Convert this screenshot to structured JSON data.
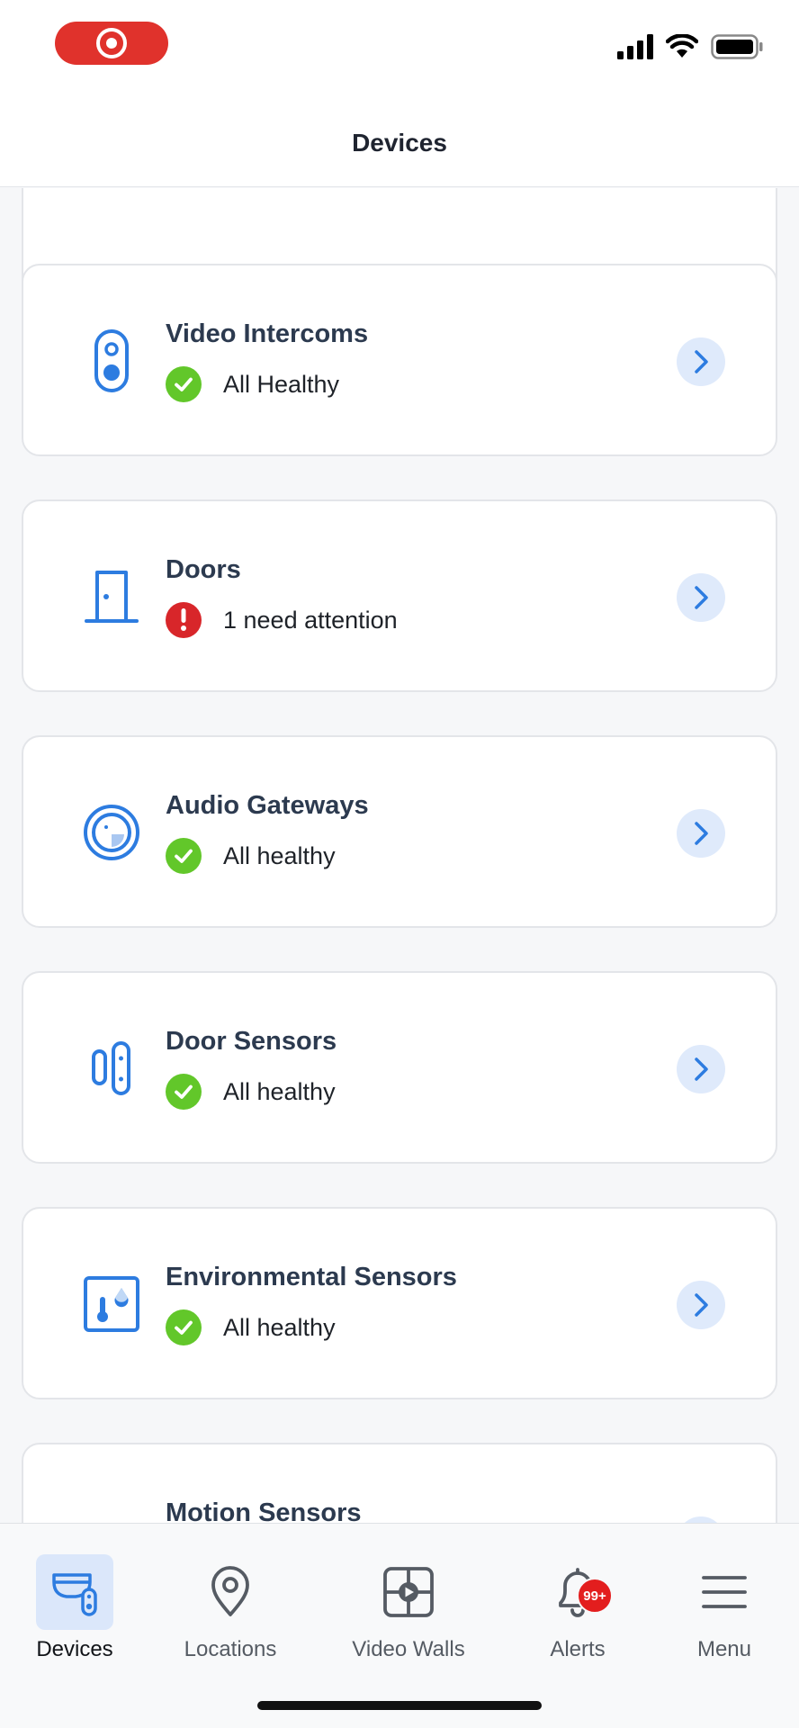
{
  "header": {
    "title": "Devices"
  },
  "colors": {
    "accent": "#2d7ce0",
    "healthy": "#62c72a",
    "alert": "#d8262a",
    "badge": "#e31e1e"
  },
  "device_groups": [
    {
      "title": "Video Intercoms",
      "status": "All Healthy",
      "status_type": "healthy",
      "icon": "video-intercom-icon"
    },
    {
      "title": "Doors",
      "status": "1 need attention",
      "status_type": "alert",
      "icon": "door-icon"
    },
    {
      "title": "Audio Gateways",
      "status": "All healthy",
      "status_type": "healthy",
      "icon": "audio-gateway-icon"
    },
    {
      "title": "Door Sensors",
      "status": "All healthy",
      "status_type": "healthy",
      "icon": "door-sensor-icon"
    },
    {
      "title": "Environmental Sensors",
      "status": "All healthy",
      "status_type": "healthy",
      "icon": "environmental-sensor-icon"
    },
    {
      "title": "Motion Sensors",
      "icon": "motion-sensor-icon"
    }
  ],
  "bottom_nav": [
    {
      "label": "Devices",
      "icon": "devices-icon",
      "active": true
    },
    {
      "label": "Locations",
      "icon": "location-pin-icon"
    },
    {
      "label": "Video Walls",
      "icon": "video-wall-icon"
    },
    {
      "label": "Alerts",
      "icon": "bell-icon",
      "badge": "99+"
    },
    {
      "label": "Menu",
      "icon": "hamburger-menu-icon"
    }
  ]
}
